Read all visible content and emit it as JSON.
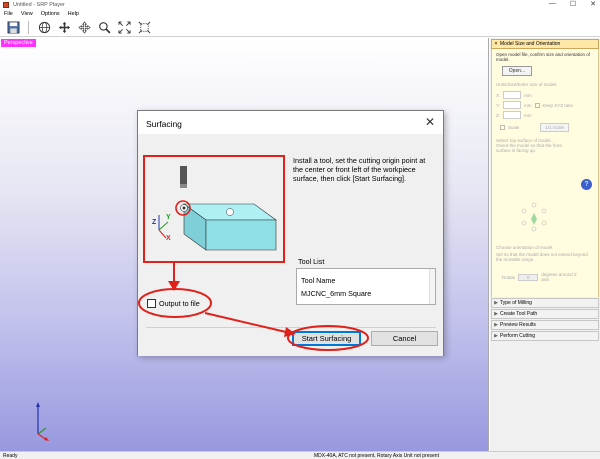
{
  "window": {
    "title": "Untitled - SRP Player",
    "min": "—",
    "max": "☐",
    "close": "✕"
  },
  "menu": [
    "File",
    "View",
    "Options",
    "Help"
  ],
  "toolbar": [
    "save-icon",
    "globe-icon",
    "move-icon",
    "pan-icon",
    "zoom-icon",
    "zoom-fit-icon",
    "zoom-window-icon"
  ],
  "viewport": {
    "tag": "Perspective"
  },
  "right_panel": {
    "header": "Model Size and Orientation",
    "intro": "Open model file, confirm size and orientation of model.",
    "open_button": "Open...",
    "units_hint": "Units/Size/Enter size of model.",
    "x_label": "X:",
    "y_label": "Y:",
    "z_label": "Z:",
    "mm": "mm",
    "keep_xyz": "Keep XYZ ratio",
    "scale_label": "Scale",
    "one_scale": "1/1 Scale",
    "top_surface": "Select top surface of model.",
    "orient_hint": "Orient the model so that the front surface is facing up.",
    "choose_orient": "Choose orientation of model.",
    "orient_hint2": "Set so that the model does not extend beyond the movable range.",
    "rotate_label": "Rotate",
    "rotate_value": "0",
    "degrees": "degrees around Z axis",
    "sections": [
      "Type of Milling",
      "Create Tool Path",
      "Preview Results",
      "Perform Cutting"
    ]
  },
  "dialog": {
    "title": "Surfacing",
    "instruction": "Install a tool, set the cutting origin point at the center or front left of the workpiece surface, then click [Start Surfacing].",
    "tool_list_label": "Tool List",
    "tool_header": "Tool Name",
    "tool_row": "MJCNC_6mm Square",
    "output_label": "Output to file",
    "output_checked": false,
    "start_label": "Start Surfacing",
    "cancel_label": "Cancel",
    "axis_z": "Z",
    "axis_y": "Y",
    "axis_x": "X"
  },
  "status": {
    "left": "Ready",
    "center": "MDX-40A, ATC not present, Rotary Axis Unit not present"
  },
  "colors": {
    "highlight": "#e0201b",
    "tag": "#ff33ff",
    "panel_header": "#ffe7a8",
    "workpiece": "#8fe0e6"
  }
}
